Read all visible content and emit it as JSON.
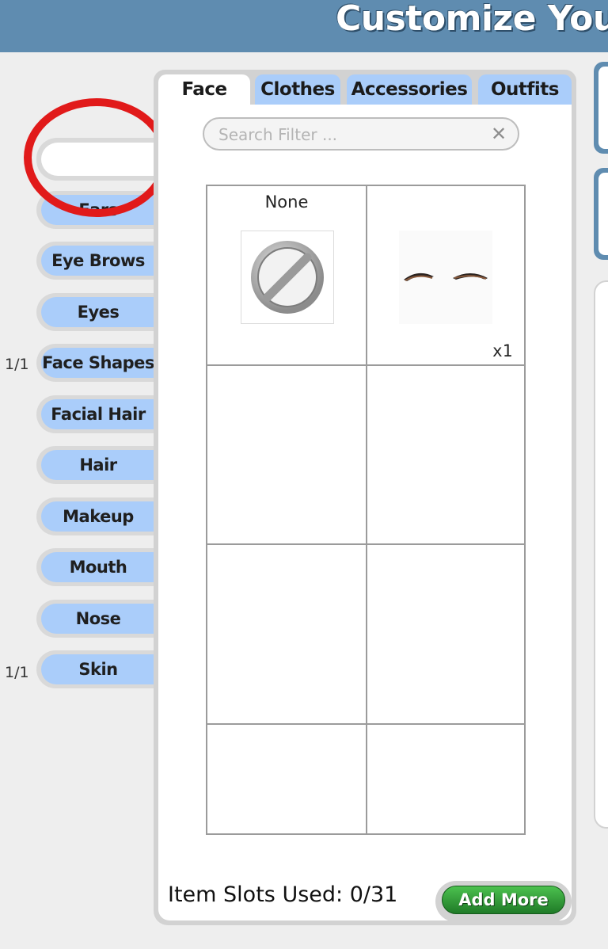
{
  "header": {
    "title": "Customize Your"
  },
  "categories": [
    {
      "label": "Ears",
      "count": ""
    },
    {
      "label": "Eye Brows",
      "count": ""
    },
    {
      "label": "Eyes",
      "count": ""
    },
    {
      "label": "Face Shapes",
      "count": "1/1"
    },
    {
      "label": "Facial Hair",
      "count": ""
    },
    {
      "label": "Hair",
      "count": ""
    },
    {
      "label": "Makeup",
      "count": ""
    },
    {
      "label": "Mouth",
      "count": ""
    },
    {
      "label": "Nose",
      "count": ""
    },
    {
      "label": "Skin",
      "count": "1/1"
    }
  ],
  "tabs": [
    {
      "label": "Face",
      "active": true
    },
    {
      "label": "Clothes",
      "active": false
    },
    {
      "label": "Accessories",
      "active": false
    },
    {
      "label": "Outfits",
      "active": false
    }
  ],
  "search": {
    "placeholder": "Search Filter ...",
    "value": ""
  },
  "items": [
    {
      "label": "None",
      "icon": "none-icon"
    },
    {
      "label": "",
      "icon": "eyebrows-icon",
      "quantity": "x1"
    }
  ],
  "footer": {
    "slots_used": "Item Slots Used: 0/31",
    "add_more": "Add More"
  },
  "colors": {
    "header": "#5f8cb0",
    "tab": "#aacdfa",
    "button": "#2e9a35",
    "highlight": "#e11a1a"
  },
  "annotation": {
    "shape": "circle",
    "color": "red"
  }
}
